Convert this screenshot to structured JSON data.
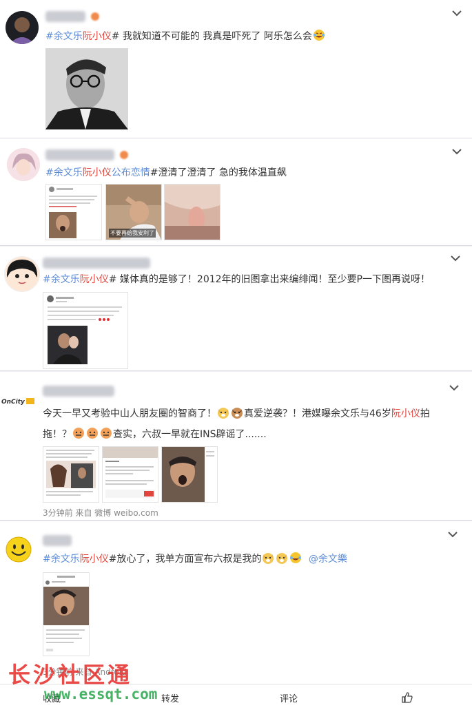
{
  "posts": [
    {
      "text_parts": [
        "#余文乐",
        "阮小仪",
        "# 我就知道不可能的 我真是吓死了 阿乐怎么会"
      ]
    },
    {
      "text_parts": [
        "#余文乐",
        "阮小仪",
        "公布恋情",
        "#澄清了澄清了 急的我体温直飙"
      ],
      "thumb2_caption": "不要再给我安利了"
    },
    {
      "text_parts": [
        "#余文乐",
        "阮小仪",
        "# 媒体真的是够了！2012年的旧图拿出来编绯闻！至少要P一下图再说呀！"
      ]
    },
    {
      "avatar_text": "OnCity",
      "line1": "今天一早又考验中山人朋友圈的智商了！",
      "line1b": "真爱逆袭？！港媒曝余文乐与46岁",
      "line1_hl": "阮小仪",
      "line1c": "拍",
      "line2a": "拖！？",
      "line2b": "查实，六叔一早就在INS辟谣了.......",
      "meta": "3分钟前 来自 微博 weibo.com"
    },
    {
      "text_parts": [
        "#余文乐",
        "阮小仪",
        "#放心了，我单方面宣布六叔是我的"
      ],
      "mention": "@余文樂",
      "meta": "3分钟前 来自 Android"
    }
  ],
  "actions": {
    "collect": "收藏",
    "repost": "转发",
    "comment": "评论"
  },
  "watermark": {
    "line1": "长沙社区通",
    "line2": "www.essqt.com"
  },
  "colors": {
    "topic_blue": "#5b8bd6",
    "highlight_red": "#e0463e",
    "watermark_red": "#e8322e",
    "watermark_green": "#2fa84f"
  }
}
